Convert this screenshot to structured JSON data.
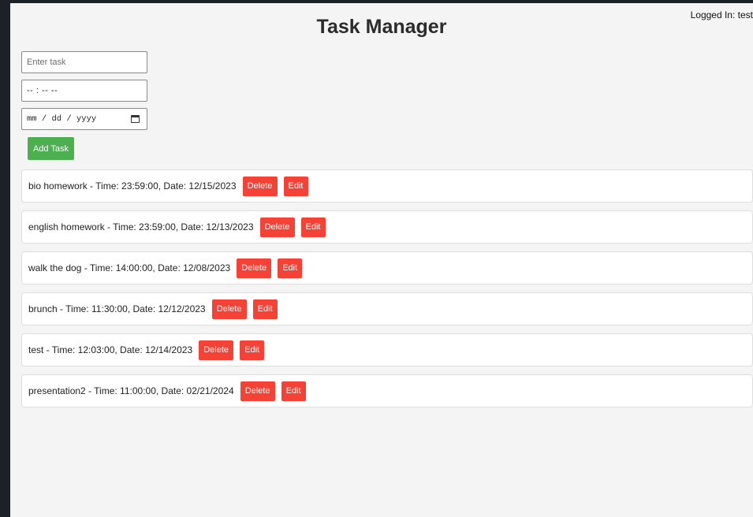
{
  "header": {
    "title": "Task Manager",
    "login_status": "Logged In: test"
  },
  "form": {
    "task_placeholder": "Enter task",
    "time_value": "-- : --   --",
    "date_value": "mm / dd / yyyy",
    "add_button_label": "Add Task"
  },
  "tasks": [
    {
      "text": "bio homework - Time: 23:59:00, Date: 12/15/2023",
      "delete_label": "Delete",
      "edit_label": "Edit"
    },
    {
      "text": "english homework - Time: 23:59:00, Date: 12/13/2023",
      "delete_label": "Delete",
      "edit_label": "Edit"
    },
    {
      "text": "walk the dog - Time: 14:00:00, Date: 12/08/2023",
      "delete_label": "Delete",
      "edit_label": "Edit"
    },
    {
      "text": "brunch - Time: 11:30:00, Date: 12/12/2023",
      "delete_label": "Delete",
      "edit_label": "Edit"
    },
    {
      "text": "test - Time: 12:03:00, Date: 12/14/2023",
      "delete_label": "Delete",
      "edit_label": "Edit"
    },
    {
      "text": "presentation2 - Time: 11:00:00, Date: 02/21/2024",
      "delete_label": "Delete",
      "edit_label": "Edit"
    }
  ],
  "colors": {
    "add_button": "#4caf50",
    "action_button": "#f44336",
    "background": "#f4f4f4"
  },
  "icons": {
    "date_picker": "calendar-icon"
  }
}
